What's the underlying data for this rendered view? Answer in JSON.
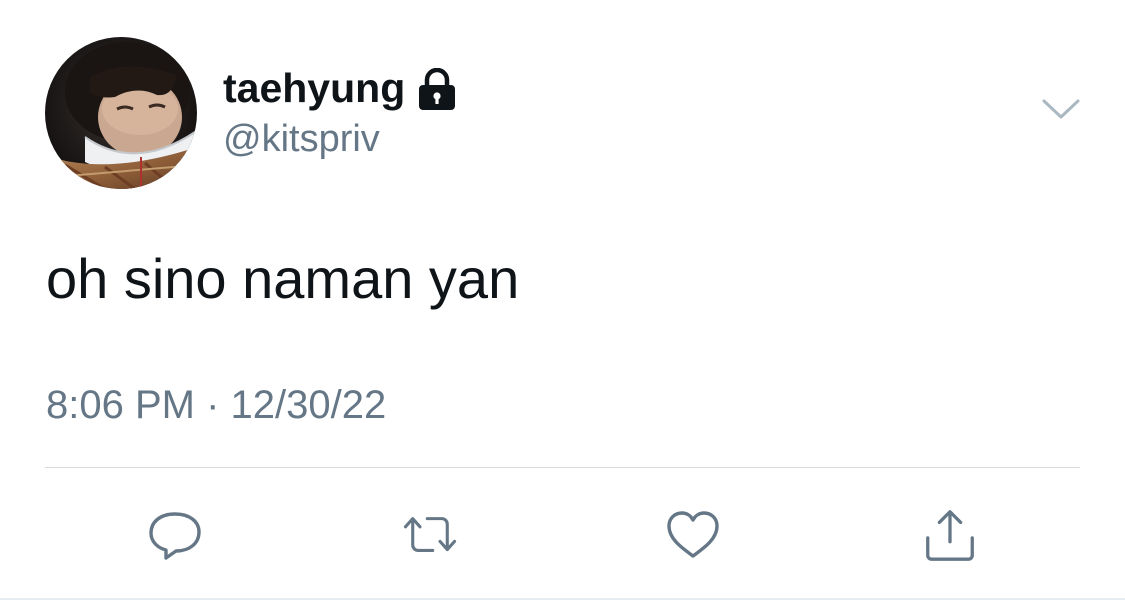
{
  "user": {
    "display_name": "taehyung",
    "handle": "@kitspriv",
    "locked_icon": "lock-icon",
    "avatar": "profile-photo"
  },
  "tweet": {
    "text": "oh sino naman yan",
    "time": "8:06 PM",
    "separator": " · ",
    "date": "12/30/22"
  },
  "actions": [
    {
      "name": "reply",
      "icon": "speech-bubble-icon"
    },
    {
      "name": "retweet",
      "icon": "retweet-arrows-icon"
    },
    {
      "name": "like",
      "icon": "heart-icon"
    },
    {
      "name": "share",
      "icon": "share-upload-icon"
    }
  ],
  "colors": {
    "text": "#0f1419",
    "secondary": "#657786",
    "icon": "#657786",
    "divider": "#d6dbe0"
  }
}
